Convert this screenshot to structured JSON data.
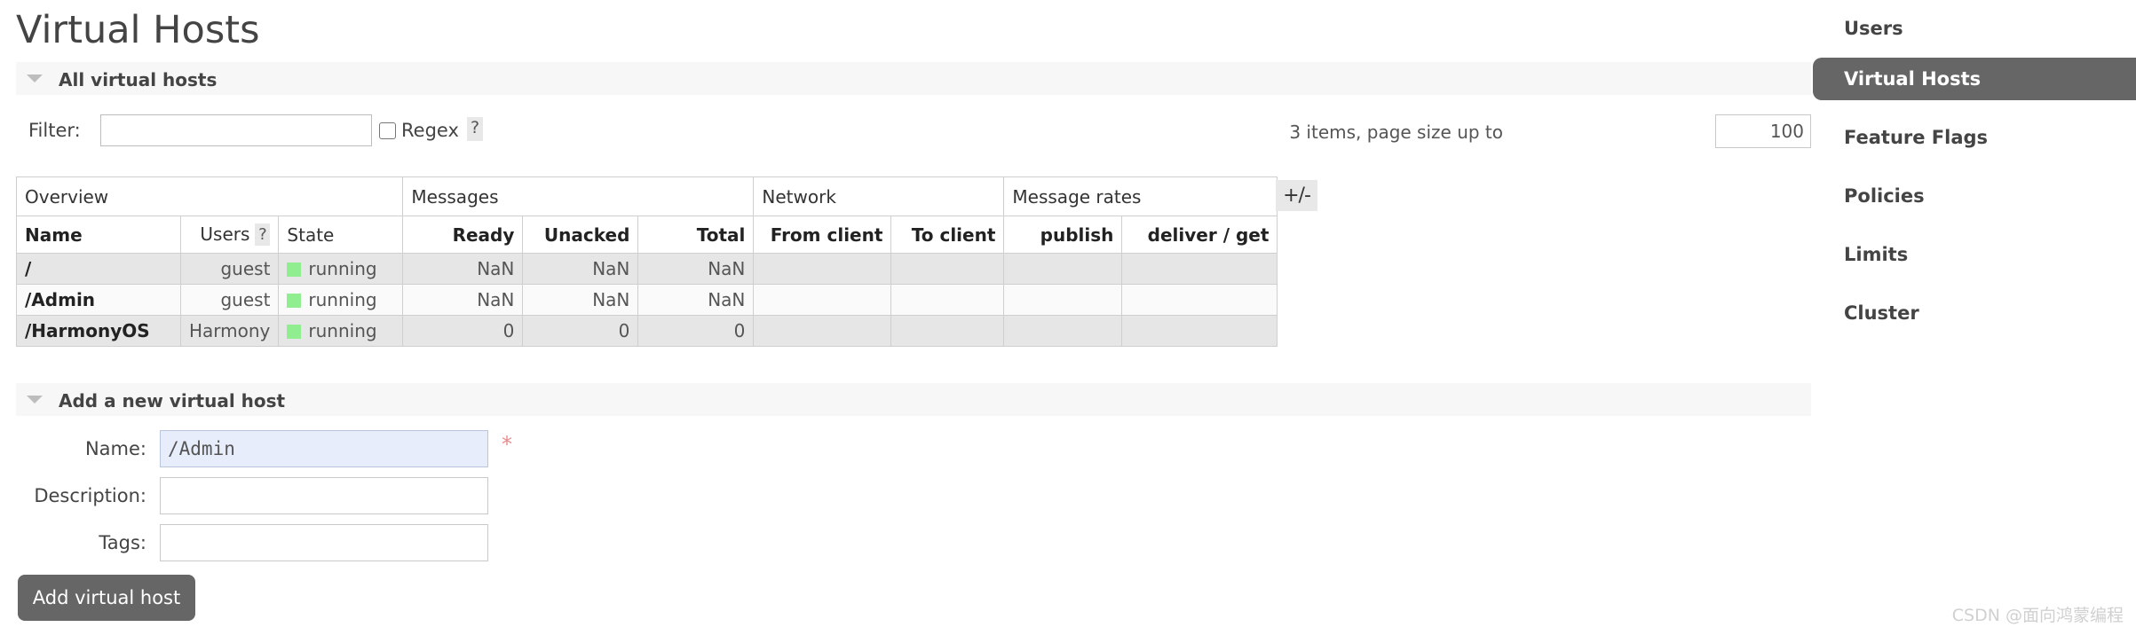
{
  "page": {
    "title": "Virtual Hosts"
  },
  "sections": {
    "all_hosts": {
      "label": "All virtual hosts",
      "caret": "caret-down-icon"
    },
    "add_host": {
      "label": "Add a new virtual host",
      "caret": "caret-down-icon"
    }
  },
  "filter": {
    "label": "Filter:",
    "value": "",
    "placeholder": "",
    "regex_label": "Regex",
    "regex_checked": false,
    "help": "?"
  },
  "paging": {
    "summary": "3 items, page size up to",
    "page_size": "100"
  },
  "table": {
    "groups": [
      {
        "label": "Overview",
        "span": 3
      },
      {
        "label": "Messages",
        "span": 3
      },
      {
        "label": "Network",
        "span": 2
      },
      {
        "label": "Message rates",
        "span": 2
      }
    ],
    "columns": [
      {
        "label": "Name",
        "align": "left"
      },
      {
        "label": "Users",
        "align": "right",
        "help": "?"
      },
      {
        "label": "State",
        "align": "left"
      },
      {
        "label": "Ready",
        "align": "right"
      },
      {
        "label": "Unacked",
        "align": "right"
      },
      {
        "label": "Total",
        "align": "right"
      },
      {
        "label": "From client",
        "align": "right"
      },
      {
        "label": "To client",
        "align": "right"
      },
      {
        "label": "publish",
        "align": "right"
      },
      {
        "label": "deliver / get",
        "align": "right"
      }
    ],
    "rows": [
      {
        "name": "/",
        "users": "guest",
        "state": "running",
        "state_color": "#90ee90",
        "ready": "NaN",
        "unacked": "NaN",
        "total": "NaN",
        "from_client": "",
        "to_client": "",
        "publish": "",
        "deliver_get": ""
      },
      {
        "name": "/Admin",
        "users": "guest",
        "state": "running",
        "state_color": "#90ee90",
        "ready": "NaN",
        "unacked": "NaN",
        "total": "NaN",
        "from_client": "",
        "to_client": "",
        "publish": "",
        "deliver_get": ""
      },
      {
        "name": "/HarmonyOS",
        "users": "Harmony",
        "state": "running",
        "state_color": "#90ee90",
        "ready": "0",
        "unacked": "0",
        "total": "0",
        "from_client": "",
        "to_client": "",
        "publish": "",
        "deliver_get": ""
      }
    ],
    "toggle_columns_label": "+/-"
  },
  "form": {
    "name_label": "Name:",
    "name_value": "/Admin",
    "required_marker": "*",
    "description_label": "Description:",
    "description_value": "",
    "tags_label": "Tags:",
    "tags_value": "",
    "submit_label": "Add virtual host"
  },
  "sidebar": {
    "items": [
      {
        "label": "Users",
        "active": false
      },
      {
        "label": "Virtual Hosts",
        "active": true
      },
      {
        "label": "Feature Flags",
        "active": false
      },
      {
        "label": "Policies",
        "active": false
      },
      {
        "label": "Limits",
        "active": false
      },
      {
        "label": "Cluster",
        "active": false
      }
    ]
  },
  "watermark": {
    "text": "CSDN @面向鸿蒙编程"
  },
  "colors": {
    "accent": "#666666",
    "status_running": "#90ee90",
    "band": "#f7f7f7",
    "required": "#e88b8b"
  }
}
